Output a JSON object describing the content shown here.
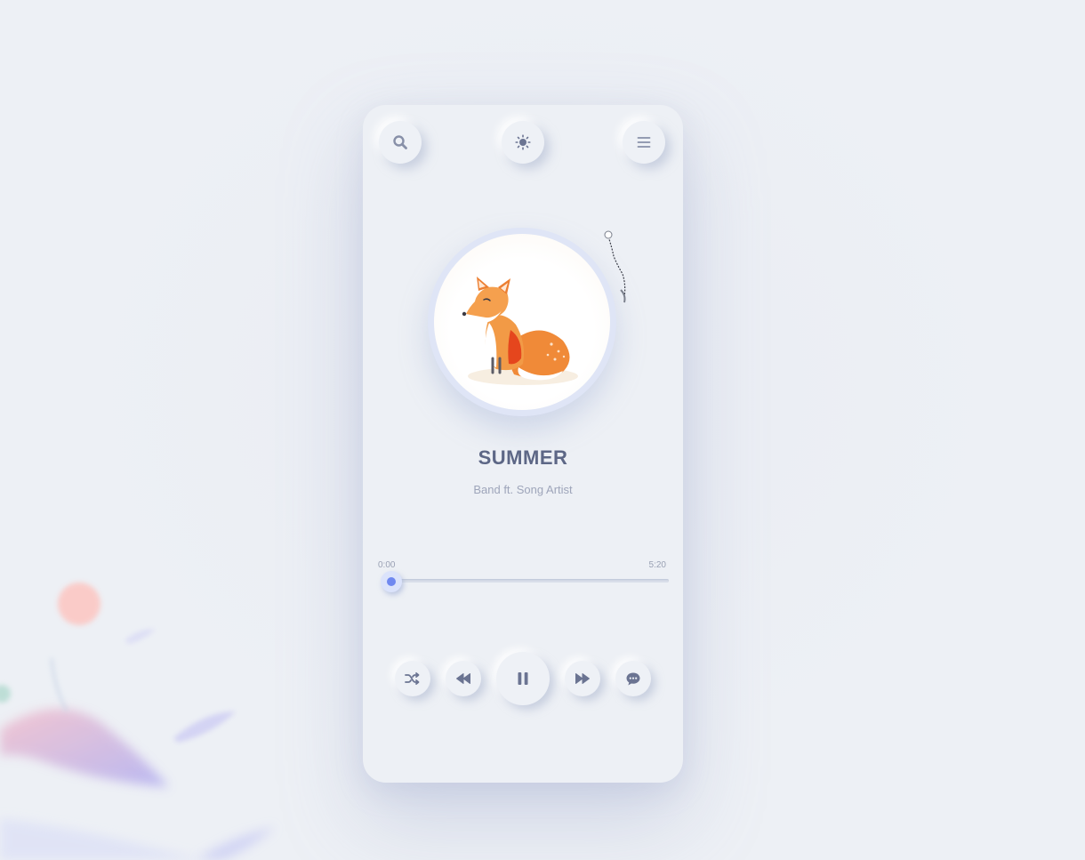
{
  "header": {
    "search_icon": "search-icon",
    "theme_icon": "sun-icon",
    "menu_icon": "hamburger-menu-icon"
  },
  "track": {
    "title": "SUMMER",
    "artist": "Band ft. Song Artist",
    "album_art": "fox-illustration"
  },
  "progress": {
    "current_time": "0:00",
    "total_time": "5:20",
    "fraction": 0.0
  },
  "controls": {
    "shuffle_icon": "shuffle-icon",
    "previous_icon": "rewind-icon",
    "play_pause_icon": "pause-icon",
    "next_icon": "fast-forward-icon",
    "chat_icon": "chat-bubble-icon"
  },
  "colors": {
    "background": "#edf0f5",
    "title": "#5d6786",
    "subtitle": "#9ea5ba",
    "accent": "#6f88f0",
    "icon": "#8890a8"
  }
}
